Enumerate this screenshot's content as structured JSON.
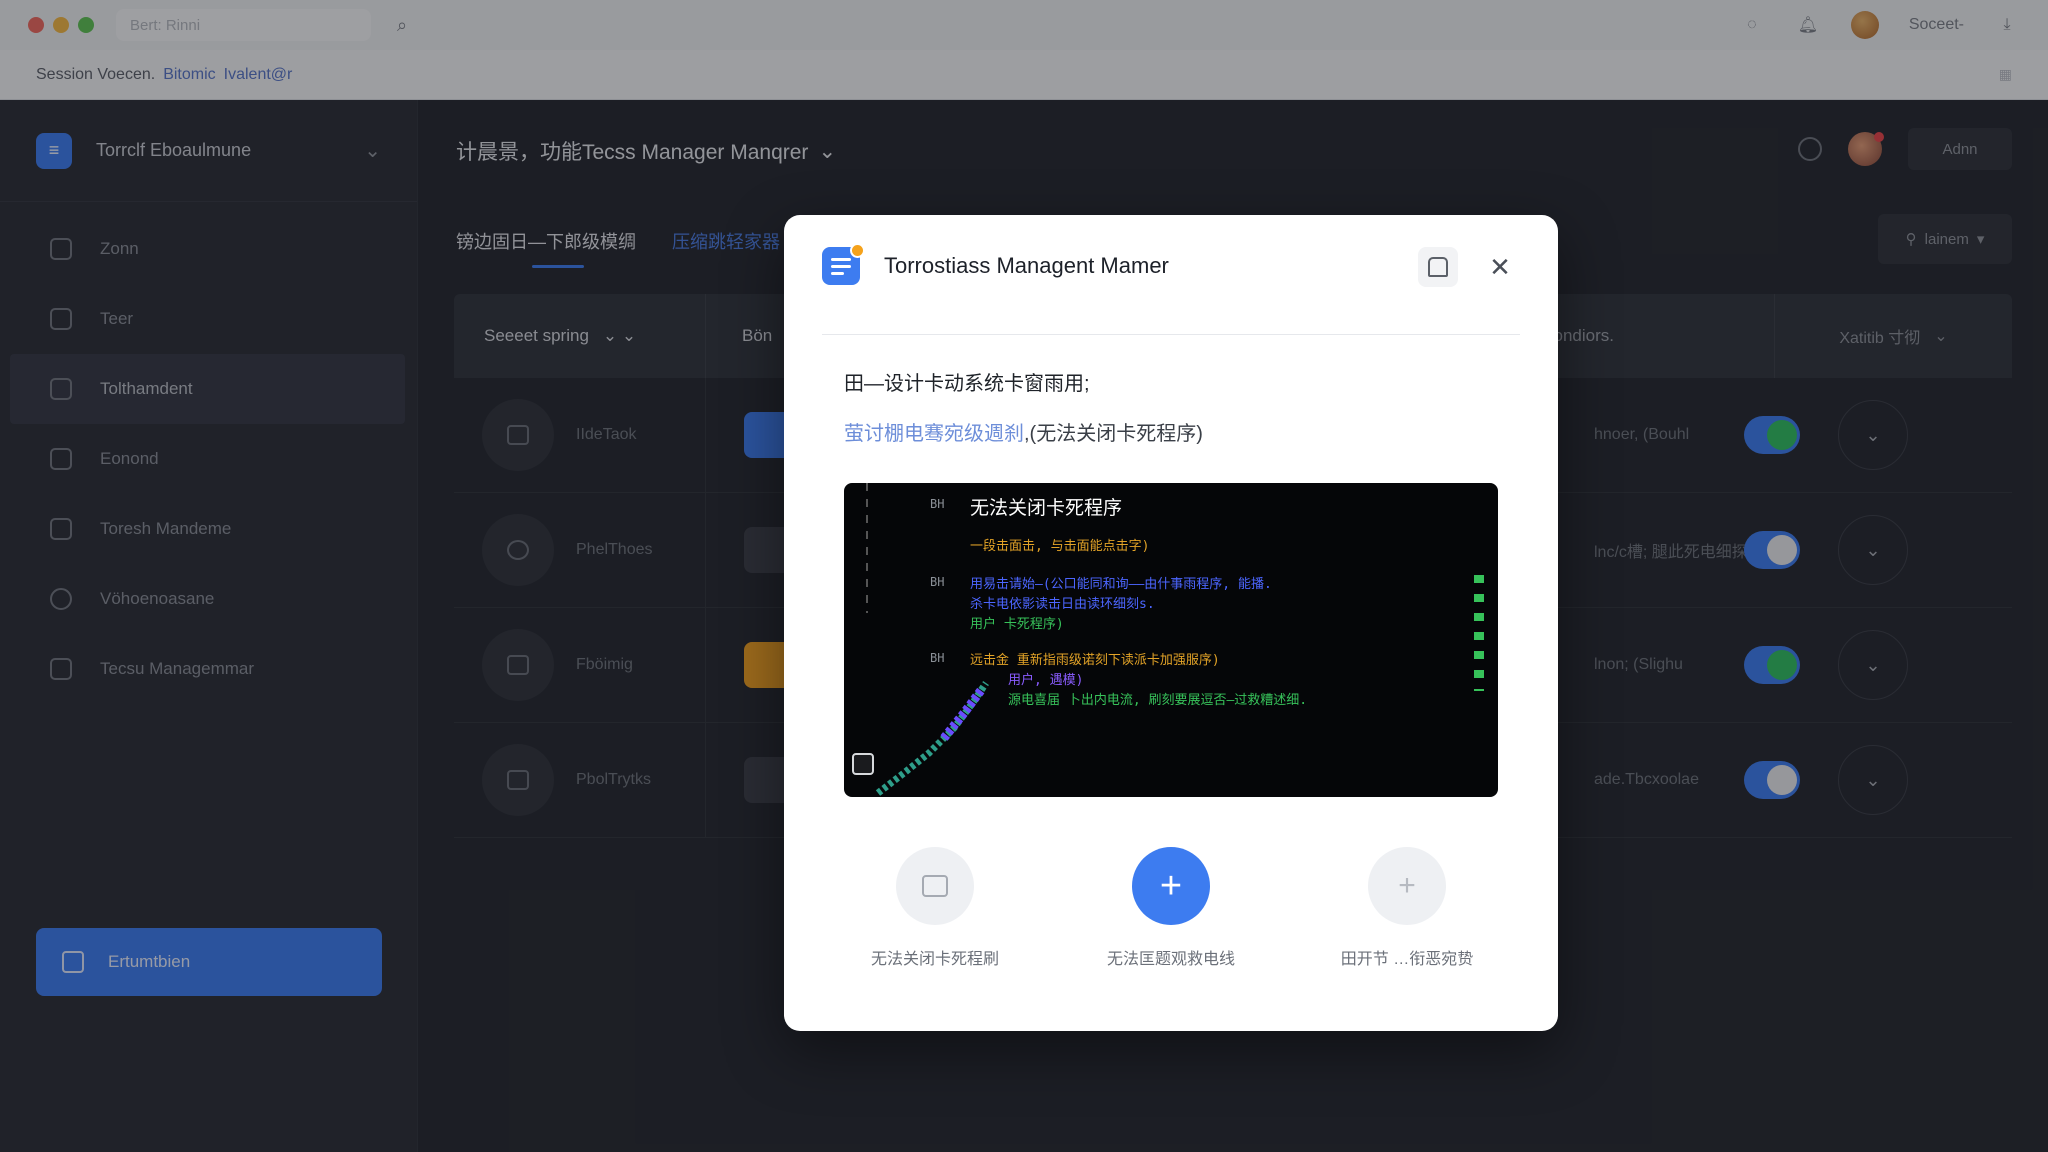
{
  "topbar": {
    "tab_text": "Bert: Rinni",
    "right_text": "Soceet-"
  },
  "crumbs": {
    "text": "Session Voecen.",
    "link1": "Bitomic",
    "link2": "Ivalent@r"
  },
  "sidebar": {
    "brand": "Torrclf Eboaulmune",
    "items": [
      {
        "label": "Zonn",
        "icon": "layers-icon"
      },
      {
        "label": "Teer",
        "icon": "users-icon"
      },
      {
        "label": "Tolthamdent",
        "icon": "home-icon"
      },
      {
        "label": "Eonond",
        "icon": "edit-icon"
      },
      {
        "label": "Toresh Mandeme",
        "icon": "document-icon"
      },
      {
        "label": "Vöhoenoasane",
        "icon": "eye-icon"
      },
      {
        "label": "Tecsu Managemmar",
        "icon": "grid-icon"
      }
    ],
    "bottom_button": "Ertumtbien"
  },
  "main": {
    "title": "计晨景，功能Tecss Manager Manqrer",
    "head_button": "Adnn",
    "subtabs": [
      "镑边固日—下郎级模绸",
      "压缩跳轻家器"
    ],
    "filter_button": "lainem",
    "table": {
      "headers": [
        "Seeeet spring",
        "Bön",
        "is sondiors.",
        "Xatitib 寸彻"
      ],
      "rows": [
        {
          "name": "IIdeTaok",
          "badge_color": "#3d7cf0",
          "status": "hnoer, (Bouhl",
          "toggle_knob": "#2fbe62"
        },
        {
          "name": "PhelThoes",
          "badge_color": "#3a3e47",
          "status": "lnc/c槽; 腿此死电细探}",
          "toggle_knob": "#e9ebee"
        },
        {
          "name": "Fböimig",
          "badge_color": "#f3a221",
          "status": "lnon; (Slighu",
          "toggle_knob": "#2fbe62"
        },
        {
          "name": "PbolTrytks",
          "badge_color": "#3a3e47",
          "status": "ade.Tbcxoolae",
          "toggle_knob": "#e9ebee"
        }
      ]
    }
  },
  "modal": {
    "title": "Torrostiass Managent Mamer",
    "line1": "田—设计卡动系统卡窗雨用;",
    "line2_link": "萤讨棚电骞宛级週刹",
    "line2_rest": ",(无法关闭卡死程序)",
    "terminal": {
      "heading": "无法关闭卡死程序",
      "markers": [
        "BH",
        "BH",
        "BH"
      ],
      "lines": [
        {
          "text": "一段击面击, 与击面能点击字)",
          "color": "#e3a327"
        },
        {
          "text": "用易击请始—(公口能同和询——由什事雨程序, 能播.",
          "color": "#4c66ff"
        },
        {
          "text": "杀卡电依影读击日由读环细刻s.",
          "color": "#4c66ff"
        },
        {
          "text": "用户 卡死程序)",
          "color": "#37c25a"
        },
        {
          "text": "远击金 重新指雨级诺刻下读派卡加强服序)",
          "color": "#e3a327"
        },
        {
          "text": "用户,  遇模)",
          "color": "#8a5cff"
        },
        {
          "text": "源电喜届 卜出内电流, 刷刻要展逗否—过救糟述细.",
          "color": "#37c25a"
        }
      ]
    },
    "actions": [
      {
        "label": "无法关闭卡死程刷",
        "icon": "square-icon"
      },
      {
        "label": "无法匡题观救电线",
        "icon": "plus-icon"
      },
      {
        "label": "田开节 …衔恶宛贽",
        "icon": "plus-icon"
      }
    ]
  },
  "colors": {
    "accent": "#3d7cf0",
    "dark_bg": "#23262d",
    "success": "#2fbe62",
    "warning": "#f3a221"
  }
}
